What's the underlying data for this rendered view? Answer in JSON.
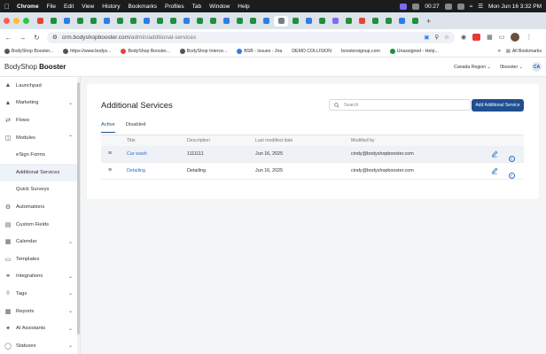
{
  "menubar": {
    "app": "Chrome",
    "menus": [
      "File",
      "Edit",
      "View",
      "History",
      "Bookmarks",
      "Profiles",
      "Tab",
      "Window",
      "Help"
    ],
    "clock_small": "00:27",
    "date_time": "Mon Jun 16  3:32 PM"
  },
  "browser": {
    "url_host": "crm.bodyshopbooster.com",
    "url_path": "/admin/additional-services",
    "bookmarks": [
      "BodyShop Booster...",
      "https://www.bodys...",
      "BodyShop Booster...",
      "BodyShop Interce...",
      "BSB - Issues - Jira",
      "DEMO COLLISION",
      "boostersignup.com",
      "Unassigned - Help..."
    ],
    "all_bookmarks": "All Bookmarks"
  },
  "app_header": {
    "brand_plain": "BodyShop ",
    "brand_bold": "Booster",
    "region": "Canada Region",
    "account": "0booster",
    "avatar_initials": "CA"
  },
  "sidebar": {
    "items": [
      {
        "label": "Launchpad",
        "icon": "rocket-icon",
        "chevron": false
      },
      {
        "label": "Marketing",
        "icon": "megaphone-icon",
        "chevron": "down"
      },
      {
        "label": "Flows",
        "icon": "flow-icon",
        "chevron": false
      },
      {
        "label": "Modules",
        "icon": "modules-icon",
        "chevron": "up"
      },
      {
        "label": "eSign Forms",
        "sub": true
      },
      {
        "label": "Additional Services",
        "sub": true,
        "selected": true
      },
      {
        "label": "Quick Surveys",
        "sub": true
      },
      {
        "label": "Automations",
        "icon": "automation-icon",
        "chevron": false
      },
      {
        "label": "Custom Fields",
        "icon": "fields-icon",
        "chevron": false
      },
      {
        "label": "Calendar",
        "icon": "calendar-icon",
        "chevron": "down"
      },
      {
        "label": "Templates",
        "icon": "template-icon",
        "chevron": false
      },
      {
        "label": "Integrations",
        "icon": "integration-icon",
        "chevron": "down"
      },
      {
        "label": "Tags",
        "icon": "tag-icon",
        "chevron": "down"
      },
      {
        "label": "Reports",
        "icon": "reports-icon",
        "chevron": "down"
      },
      {
        "label": "AI Assistants",
        "icon": "ai-icon",
        "chevron": "down"
      },
      {
        "label": "Statuses",
        "icon": "status-icon",
        "chevron": "down"
      }
    ]
  },
  "main": {
    "title": "Additional Services",
    "search_placeholder": "Search",
    "add_button": "Add Additional Service",
    "tabs": [
      "Active",
      "Disabled"
    ],
    "columns": [
      "Title",
      "Description",
      "Last modified date",
      "Modified by"
    ],
    "rows": [
      {
        "title": "Car wash",
        "description": "1111111",
        "date": "Jun 16, 2025",
        "modified_by": "cindy@bodyshopbooster.com"
      },
      {
        "title": "Detailing",
        "description": "Detailing",
        "date": "Jun 16, 2025",
        "modified_by": "cindy@bodyshopbooster.com"
      }
    ]
  },
  "colors": {
    "primary": "#1f4f8f",
    "link": "#2e6fc9",
    "selected_row": "#eef1f6",
    "page_bg": "#f4f5f7"
  }
}
